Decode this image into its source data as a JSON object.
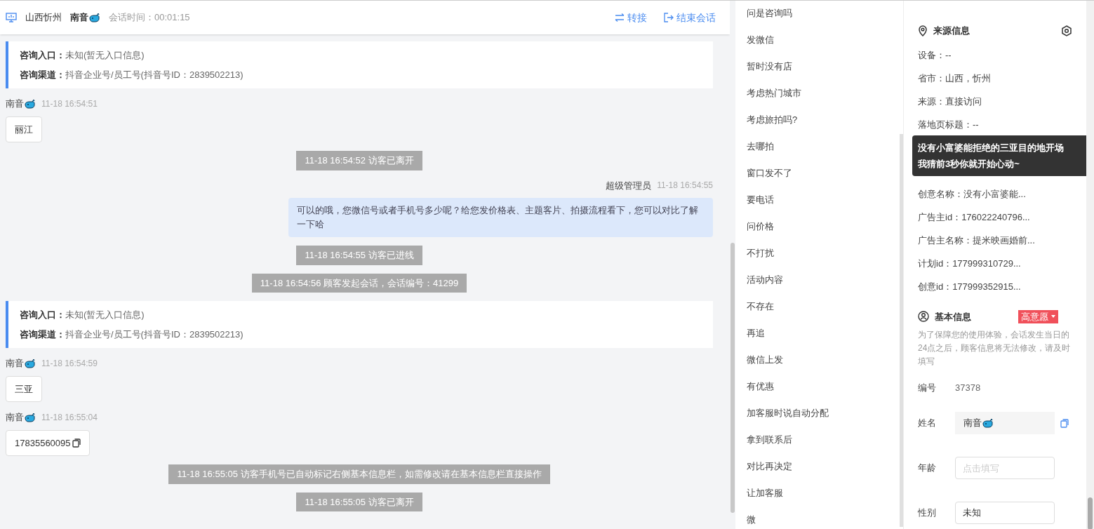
{
  "header": {
    "location": "山西忻州",
    "visitor": "南音",
    "session_label": "会话时间：",
    "session_time": "00:01:15",
    "actions": [
      {
        "kind": "transfer",
        "label": "转接"
      },
      {
        "kind": "end",
        "label": "结束会话"
      }
    ]
  },
  "messages": [
    {
      "kind": "info",
      "rows": [
        {
          "label": "咨询入口：",
          "value": "未知(暂无入口信息)"
        },
        {
          "label": "咨询渠道：",
          "value": "抖音企业号/员工号(抖音号ID：2839502213)"
        }
      ]
    },
    {
      "kind": "visitor",
      "name": "南音",
      "time": "11-18 16:54:51",
      "text": "丽江",
      "copy": false
    },
    {
      "kind": "system",
      "text": "11-18 16:54:52 访客已离开"
    },
    {
      "kind": "agent",
      "name": "超级管理员",
      "time": "11-18 16:54:55",
      "text": "可以的哦，您微信号或者手机号多少呢？给您发价格表、主题客片、拍摄流程看下，您可以对比了解一下哈"
    },
    {
      "kind": "system",
      "text": "11-18 16:54:55 访客已进线"
    },
    {
      "kind": "system",
      "text": "11-18 16:54:56 顾客发起会话，会话编号：41299"
    },
    {
      "kind": "info",
      "rows": [
        {
          "label": "咨询入口：",
          "value": "未知(暂无入口信息)"
        },
        {
          "label": "咨询渠道：",
          "value": "抖音企业号/员工号(抖音号ID：2839502213)"
        }
      ]
    },
    {
      "kind": "visitor",
      "name": "南音",
      "time": "11-18 16:54:59",
      "text": "三亚",
      "copy": false
    },
    {
      "kind": "visitor",
      "name": "南音",
      "time": "11-18 16:55:04",
      "text": "17835560095",
      "copy": true
    },
    {
      "kind": "system",
      "text": "11-18 16:55:05 访客手机号已自动标记右侧基本信息栏，如需修改请在基本信息栏直接操作"
    },
    {
      "kind": "system",
      "text": "11-18 16:55:05 访客已离开"
    }
  ],
  "phrases": [
    "问是咨询吗",
    "发微信",
    "暂时没有店",
    "考虑热门城市",
    "考虑旅拍吗?",
    "去哪拍",
    "窗口发不了",
    "要电话",
    "问价格",
    "不打扰",
    "活动内容",
    "不存在",
    "再追",
    "微信上发",
    "有优惠",
    "加客服时说自动分配",
    "拿到联系后",
    "对比再决定",
    "让加客服",
    "微"
  ],
  "source_info": {
    "title": "来源信息",
    "rows_top": [
      "设备：--",
      "省市：山西，忻州",
      "来源：直接访问",
      "落地页标题：--"
    ],
    "tooltip": [
      "没有小富婆能拒绝的三亚目的地开场",
      "我猜前3秒你就开始心动~"
    ],
    "rows_bottom": [
      {
        "label": "创意名称：",
        "value": "没有小富婆能..."
      },
      {
        "label": "广告主id：",
        "value": "176022240796..."
      },
      {
        "label": "广告主名称：",
        "value": "提米映画婚前..."
      },
      {
        "label": "计划id：",
        "value": "177999310729..."
      },
      {
        "label": "创意id：",
        "value": "177999352915..."
      }
    ]
  },
  "basic_info": {
    "title": "基本信息",
    "intent_tag": "高意愿",
    "notice": "为了保障您的使用体验，会话发生当日的24点之后，顾客信息将无法修改，请及时填写",
    "fields": [
      {
        "kind": "text",
        "label": "编号",
        "value": "37378"
      },
      {
        "kind": "input",
        "label": "姓名",
        "value": "南音",
        "emoji": true,
        "copy": true
      },
      {
        "kind": "input",
        "label": "年龄",
        "placeholder": "点击填写"
      },
      {
        "kind": "input",
        "label": "性别",
        "value": "未知"
      }
    ]
  }
}
